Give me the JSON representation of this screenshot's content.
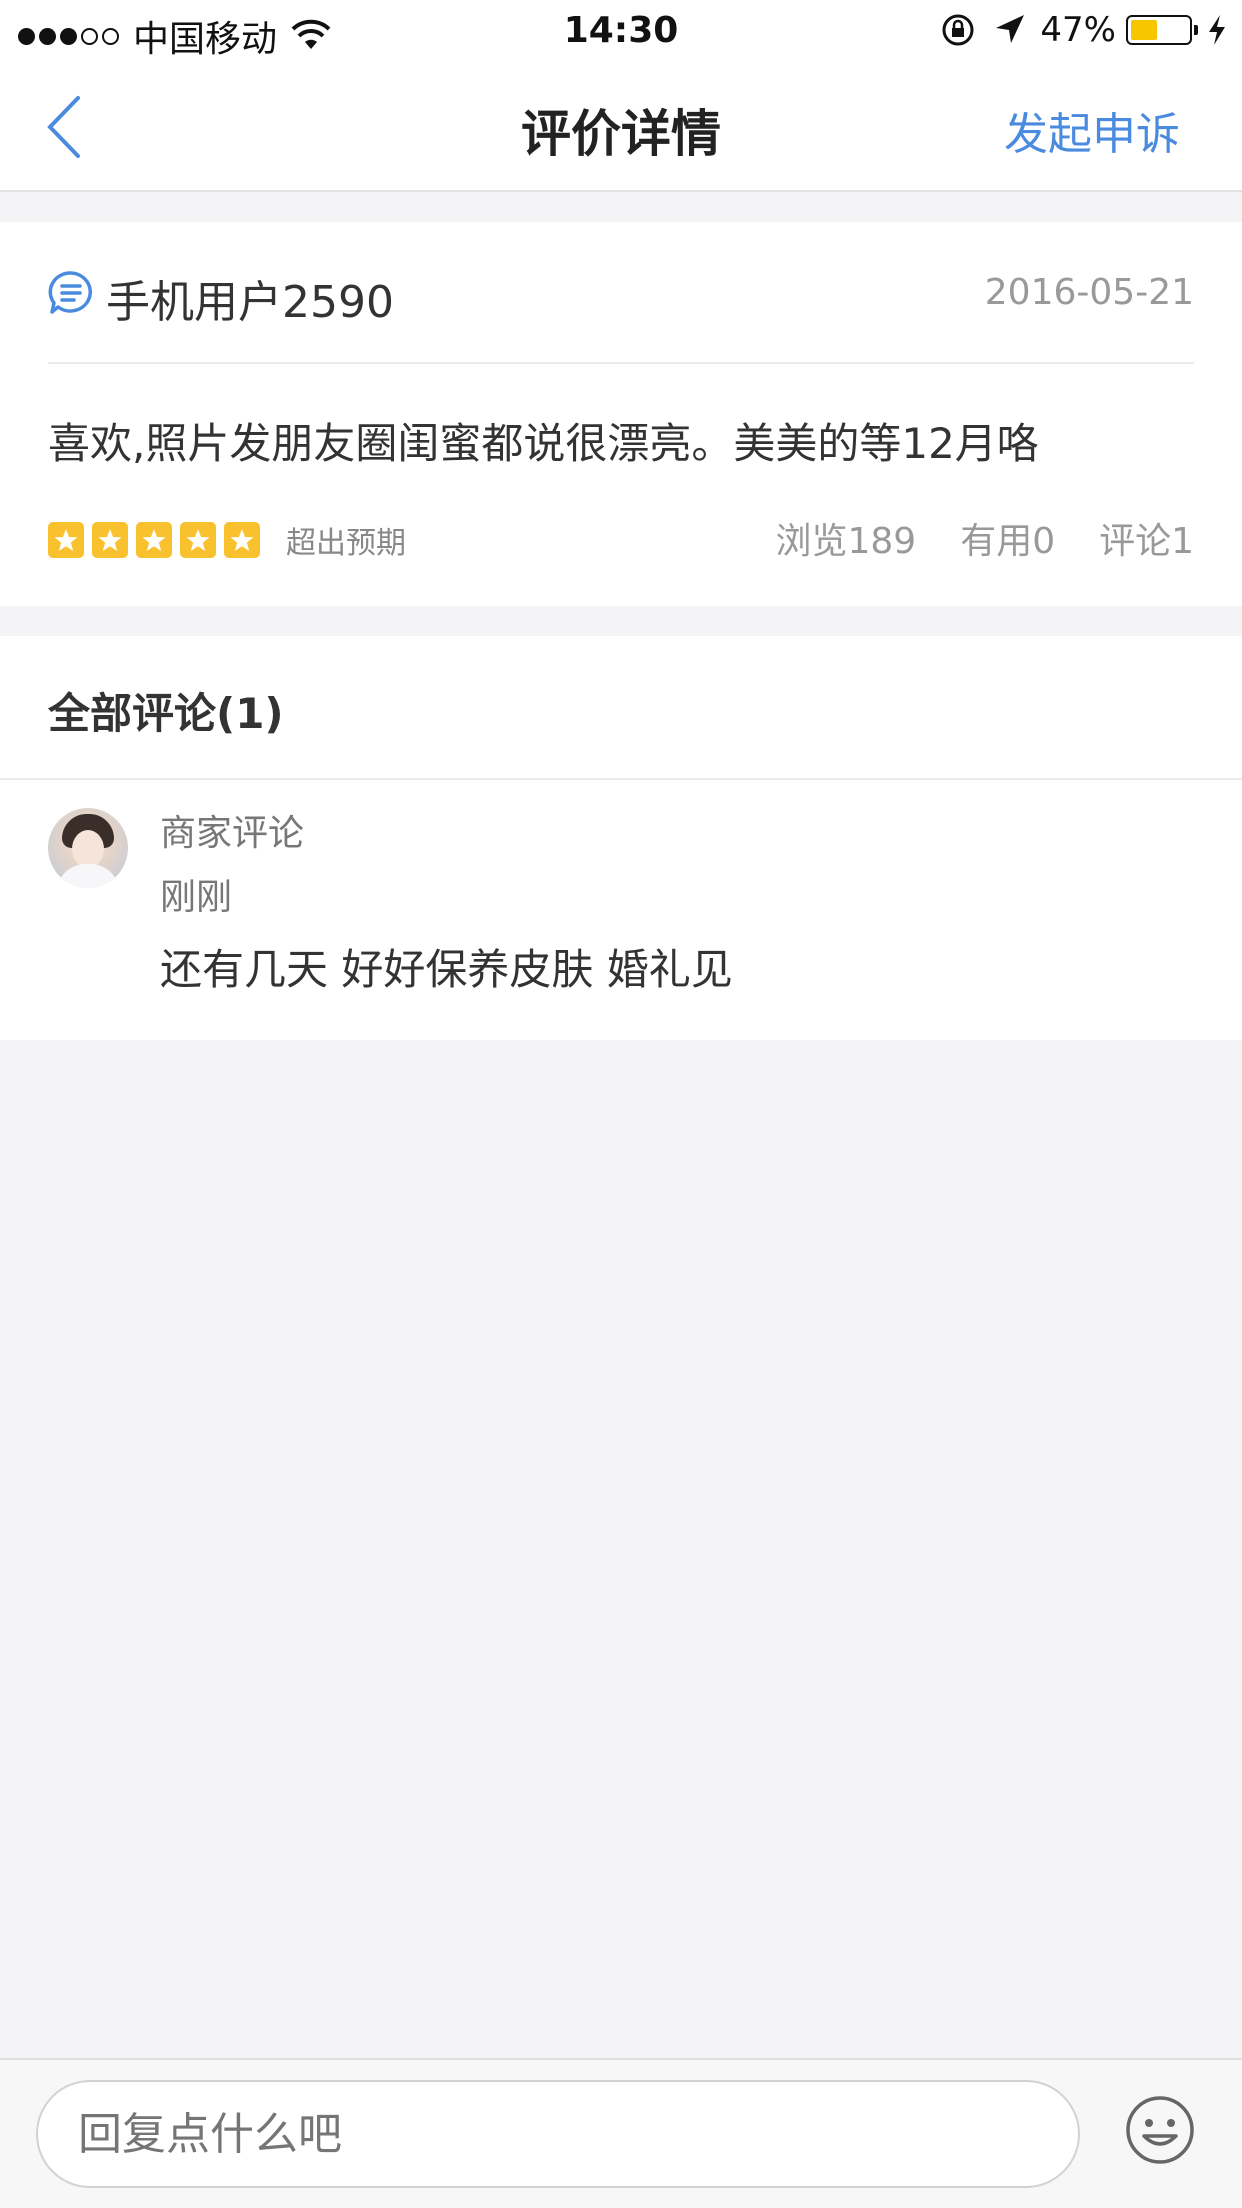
{
  "status_bar": {
    "carrier": "中国移动",
    "time": "14:30",
    "battery_percent": "47%",
    "battery_level": 0.47,
    "signal_bars": 3,
    "signal_total": 5
  },
  "nav": {
    "title": "评价详情",
    "action": "发起申诉"
  },
  "review": {
    "user": "手机用户2590",
    "date": "2016-05-21",
    "text": "喜欢,照片发朋友圈闺蜜都说很漂亮。美美的等12月咯",
    "rating": 5,
    "rating_label": "超出预期",
    "stats": {
      "views": "浏览189",
      "useful": "有用0",
      "comments": "评论1"
    }
  },
  "comments": {
    "title": "全部评论(1)",
    "items": [
      {
        "author": "商家评论",
        "time": "刚刚",
        "text": "还有几天 好好保养皮肤 婚礼见"
      }
    ]
  },
  "reply": {
    "placeholder": "回复点什么吧"
  },
  "colors": {
    "accent": "#4a8be0",
    "star": "#f8c12d",
    "background": "#f4f4f6"
  },
  "icons": {
    "back": "chevron-left-icon",
    "comment": "chat-bubble-icon",
    "emoji": "smiley-icon",
    "wifi": "wifi-icon",
    "location": "location-arrow-icon",
    "lock": "rotation-lock-icon"
  }
}
